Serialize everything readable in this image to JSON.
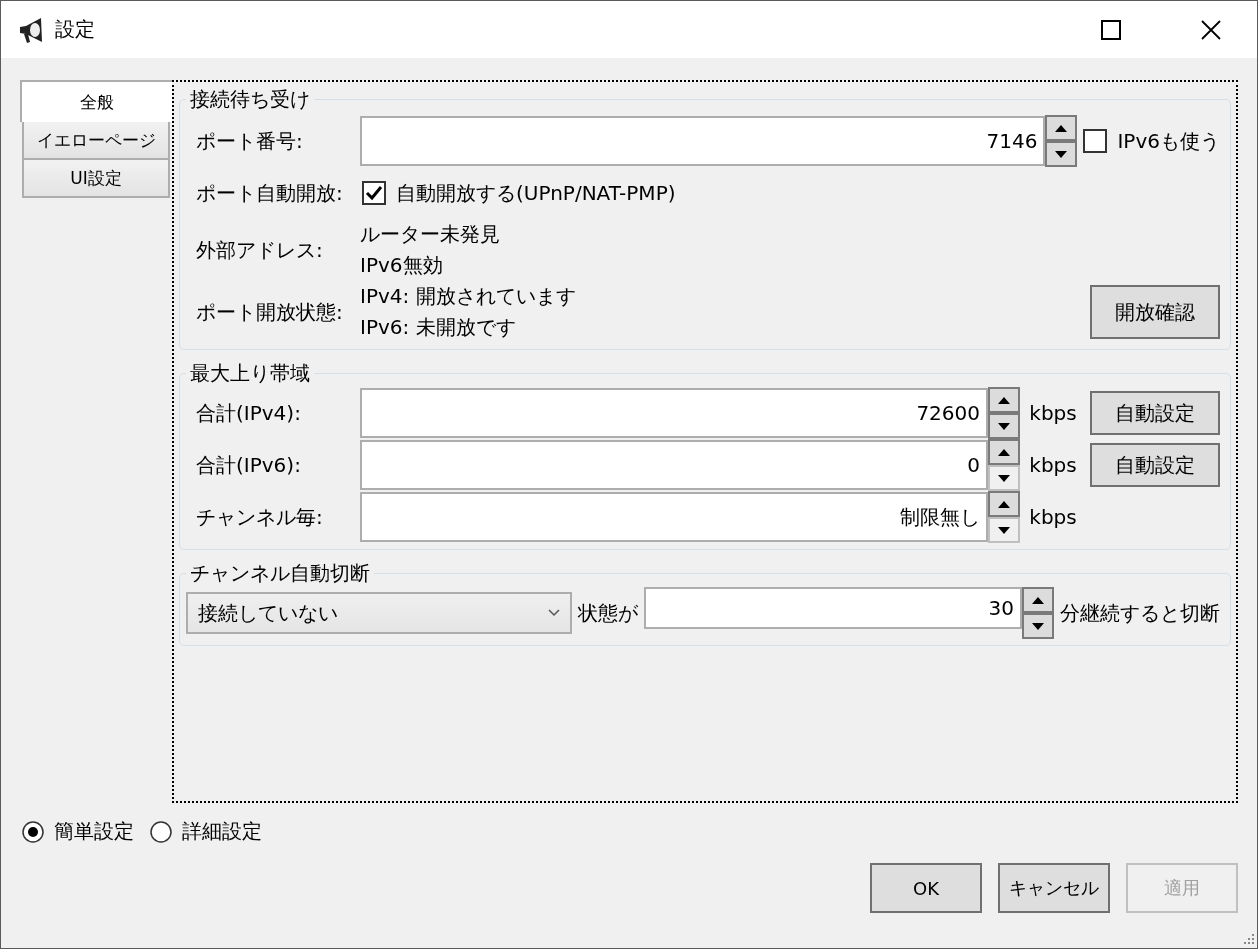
{
  "window": {
    "title": "設定"
  },
  "tabs": [
    {
      "label": "全般",
      "selected": true
    },
    {
      "label": "イエローページ",
      "selected": false
    },
    {
      "label": "UI設定",
      "selected": false
    }
  ],
  "listen": {
    "title": "接続待ち受け",
    "port_label": "ポート番号:",
    "port": "7146",
    "port_spin": {
      "up_enabled": true,
      "down_enabled": true
    },
    "ipv6_label": "IPv6も使う",
    "ipv6_checked": false,
    "auto_open_label": "ポート自動開放:",
    "auto_open_text": "自動開放する(UPnP/NAT-PMP)",
    "auto_open_checked": true,
    "external_label": "外部アドレス:",
    "external_lines": [
      "ルーター未発見",
      "IPv6無効"
    ],
    "status_label": "ポート開放状態:",
    "status_lines": [
      "IPv4: 開放されています",
      "IPv6: 未開放です"
    ],
    "check_button": "開放確認"
  },
  "bandwidth": {
    "title": "最大上り帯域",
    "rows": [
      {
        "label": "合計(IPv4):",
        "value": "72600",
        "unit": "kbps",
        "button": "自動設定",
        "up_enabled": true,
        "down_enabled": true
      },
      {
        "label": "合計(IPv6):",
        "value": "0",
        "unit": "kbps",
        "button": "自動設定",
        "up_enabled": true,
        "down_enabled": false
      },
      {
        "label": "チャンネル毎:",
        "value": "制限無し",
        "unit": "kbps",
        "up_enabled": true,
        "down_enabled": false
      }
    ]
  },
  "auto_disconnect": {
    "title": "チャンネル自動切断",
    "condition": "接続していない",
    "state_text": "状態が",
    "minutes": "30",
    "minutes_spin": {
      "up_enabled": true,
      "down_enabled": true
    },
    "suffix": "分継続すると切断"
  },
  "modes": [
    {
      "label": "簡単設定",
      "selected": true
    },
    {
      "label": "詳細設定",
      "selected": false
    }
  ],
  "buttons": [
    {
      "label": "OK",
      "disabled": false
    },
    {
      "label": "キャンセル",
      "disabled": false
    },
    {
      "label": "適用",
      "disabled": true
    }
  ]
}
